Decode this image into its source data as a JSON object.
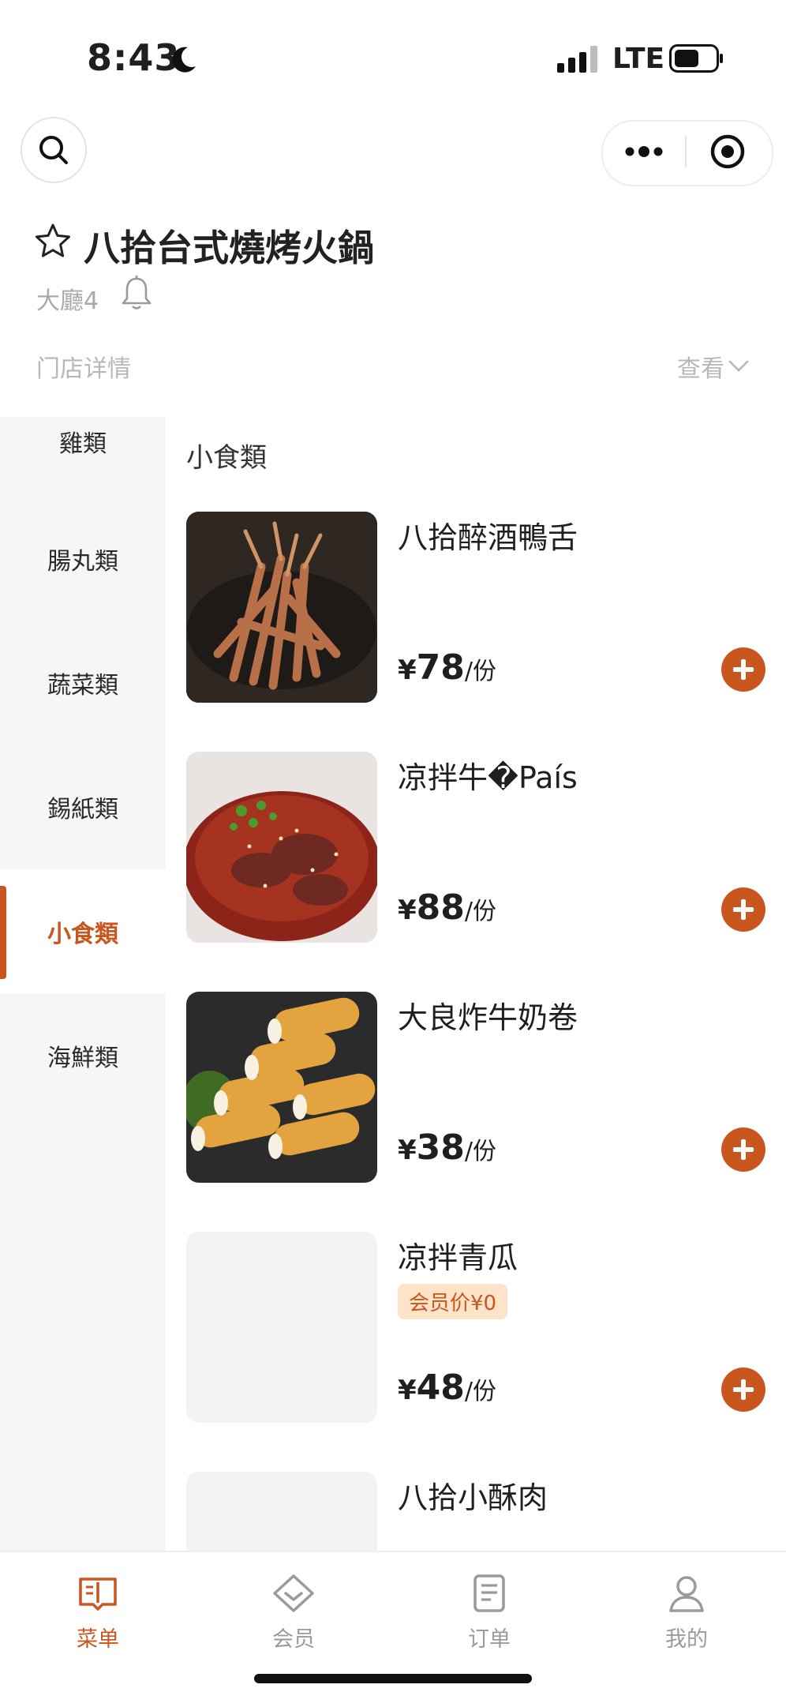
{
  "status_bar": {
    "time": "8:43",
    "network": "LTE",
    "icons": [
      "moon-icon",
      "signal-icon",
      "battery-icon"
    ]
  },
  "top_bar": {
    "icons": [
      "search-icon",
      "more-icon",
      "close-target-icon"
    ]
  },
  "store": {
    "name": "八拾台式燒烤火鍋",
    "table": "大廳4",
    "detail_label": "门店详情",
    "view_label": "查看"
  },
  "categories": [
    {
      "label": "雞類"
    },
    {
      "label": "腸丸類"
    },
    {
      "label": "蔬菜類"
    },
    {
      "label": "錫紙類"
    },
    {
      "label": "小食類",
      "active": true
    },
    {
      "label": "海鮮類"
    }
  ],
  "section": {
    "title": "小食類"
  },
  "items": [
    {
      "name": "八拾醉酒鴨舌",
      "currency": "¥",
      "price": "78",
      "unit": "/份"
    },
    {
      "name": "凉拌牛�País",
      "currency": "¥",
      "price": "88",
      "unit": "/份"
    },
    {
      "name": "大良炸牛奶卷",
      "currency": "¥",
      "price": "38",
      "unit": "/份"
    },
    {
      "name": "凉拌青瓜",
      "currency": "¥",
      "price": "48",
      "unit": "/份",
      "member_tag": "会员价¥0"
    },
    {
      "name": "八拾小酥肉"
    }
  ],
  "tabbar": [
    {
      "label": "菜单",
      "icon": "menu-book-icon",
      "active": true
    },
    {
      "label": "会员",
      "icon": "member-diamond-icon"
    },
    {
      "label": "订单",
      "icon": "order-icon"
    },
    {
      "label": "我的",
      "icon": "profile-icon"
    }
  ],
  "colors": {
    "accent": "#c9551f",
    "sidebar_bg": "#f6f6f6",
    "tag_bg": "#fde3c8"
  }
}
